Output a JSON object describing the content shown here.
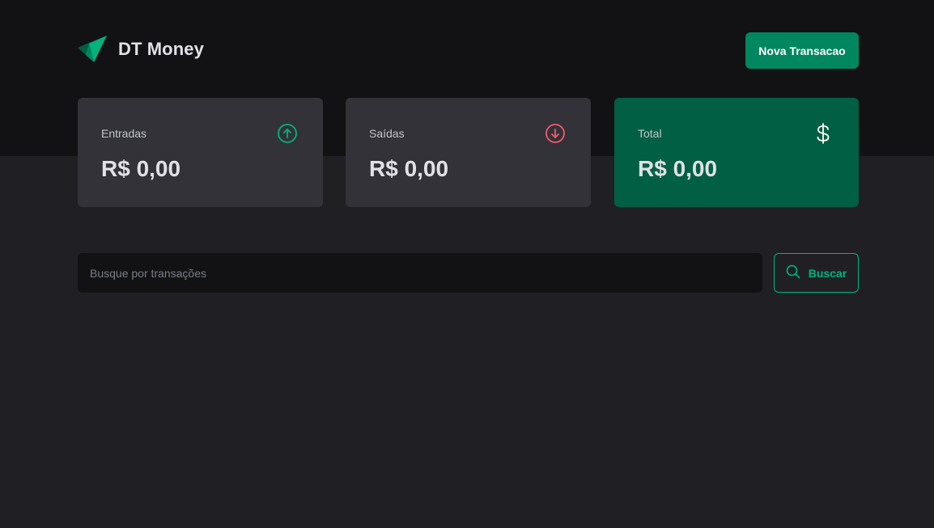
{
  "app": {
    "title": "DT Money",
    "logo_icon": "paper-plane-logo"
  },
  "header": {
    "new_transaction_label": "Nova Transacao"
  },
  "summary": {
    "income": {
      "label": "Entradas",
      "value": "R$ 0,00",
      "icon": "arrow-circle-up-icon",
      "color": "#00b37e"
    },
    "outcome": {
      "label": "Saídas",
      "value": "R$ 0,00",
      "icon": "arrow-circle-down-icon",
      "color": "#f75a68"
    },
    "total": {
      "label": "Total",
      "value": "R$ 0,00",
      "icon": "currency-dollar-icon",
      "color": "#ffffff"
    }
  },
  "search": {
    "placeholder": "Busque por transações",
    "value": "",
    "button_label": "Buscar",
    "button_icon": "magnifying-glass-icon"
  },
  "colors": {
    "background": "#202024",
    "header_background": "#121214",
    "card_background": "#323238",
    "total_card_background": "#015f43",
    "primary_button": "#00875f",
    "accent_green": "#00b37e",
    "accent_red": "#f75a68"
  }
}
